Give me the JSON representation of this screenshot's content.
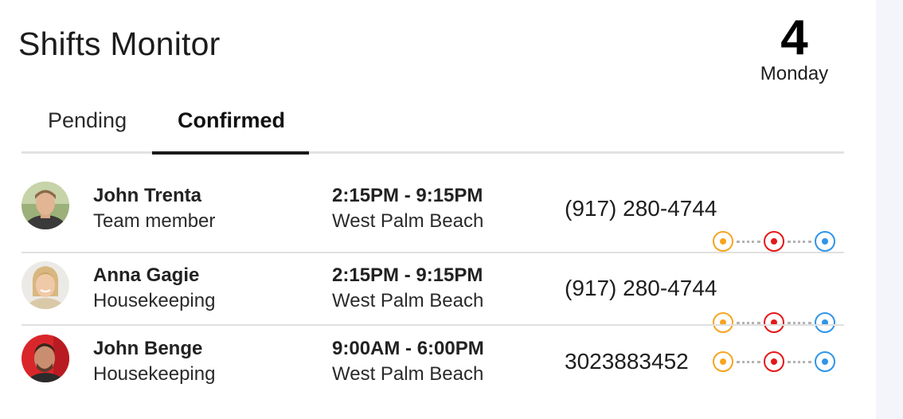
{
  "header": {
    "title": "Shifts Monitor",
    "date_number": "4",
    "date_day": "Monday"
  },
  "tabs": [
    {
      "label": "Pending",
      "active": false
    },
    {
      "label": "Confirmed",
      "active": true
    }
  ],
  "status_colors": {
    "first": "#f7a520",
    "second": "#e41818",
    "third": "#2f95e8"
  },
  "shifts": [
    {
      "name": "John Trenta",
      "role": "Team member",
      "time": "2:15PM - 9:15PM",
      "location": "West Palm Beach",
      "phone": "(917) 280-4744",
      "avatar_icon": "person-avatar-icon"
    },
    {
      "name": "Anna Gagie",
      "role": "Housekeeping",
      "time": "2:15PM - 9:15PM",
      "location": "West Palm Beach",
      "phone": "(917) 280-4744",
      "avatar_icon": "person-avatar-icon"
    },
    {
      "name": "John Benge",
      "role": "Housekeeping",
      "time": "9:00AM - 6:00PM",
      "location": "West Palm Beach",
      "phone": "3023883452",
      "avatar_icon": "person-avatar-icon"
    }
  ]
}
